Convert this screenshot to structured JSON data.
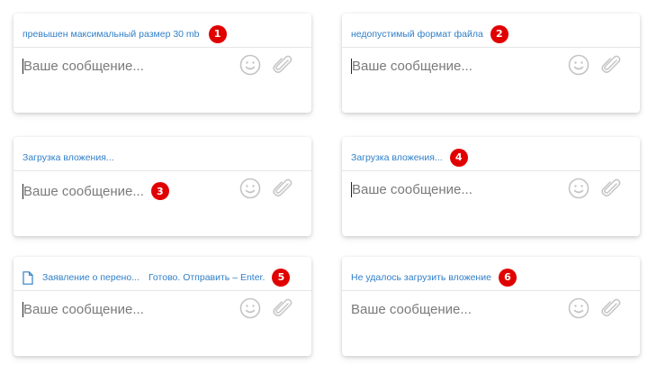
{
  "cards": [
    {
      "status": "превышен максимальный размер 30 mb",
      "placeholder": "Ваше сообщение...",
      "badge": "1"
    },
    {
      "status": "недопустимый формат файла",
      "placeholder": "Ваше сообщение...",
      "badge": "2"
    },
    {
      "status": "Загрузка вложения...",
      "placeholder": "Ваше сообщение...",
      "badge": "3"
    },
    {
      "status": "Загрузка вложения...",
      "placeholder": "Ваше сообщение...",
      "badge": "4"
    },
    {
      "file_name": "Заявление о перено...",
      "status": "Готово. Отправить – Enter.",
      "placeholder": "Ваше сообщение...",
      "badge": "5"
    },
    {
      "status": "Не удалось загрузить вложение",
      "placeholder": "Ваше сообщение...",
      "badge": "6"
    }
  ],
  "colors": {
    "status_link": "#2f7fc9",
    "placeholder": "#7a7a7a",
    "badge": "#e10000",
    "icon": "#c4c4c4"
  },
  "icons": [
    "emoji-icon",
    "paperclip-icon",
    "file-icon"
  ]
}
